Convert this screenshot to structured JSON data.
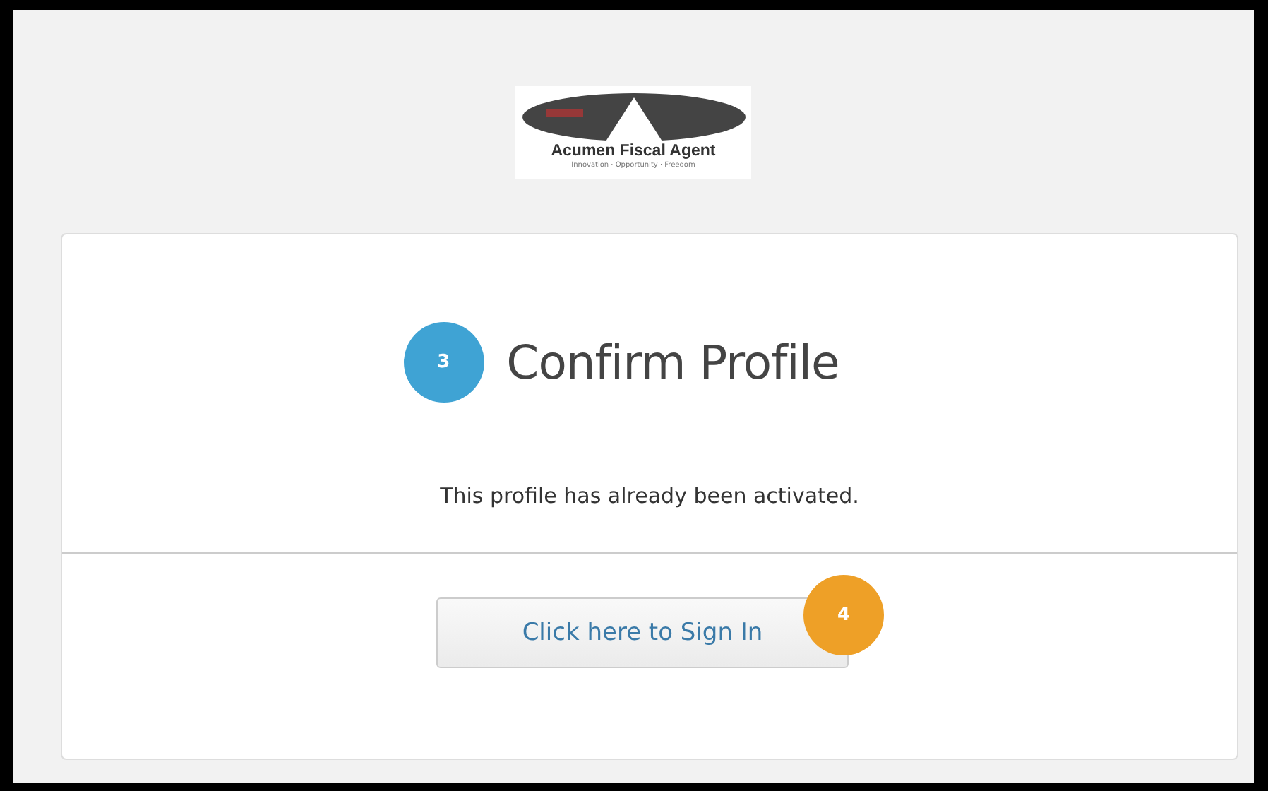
{
  "logo": {
    "name": "Acumen Fiscal Agent",
    "tagline": "Innovation · Opportunity · Freedom"
  },
  "card": {
    "step_badge": "3",
    "title": "Confirm Profile",
    "message": "This profile has already been activated.",
    "button": {
      "label": "Click here to Sign In",
      "badge": "4"
    }
  }
}
